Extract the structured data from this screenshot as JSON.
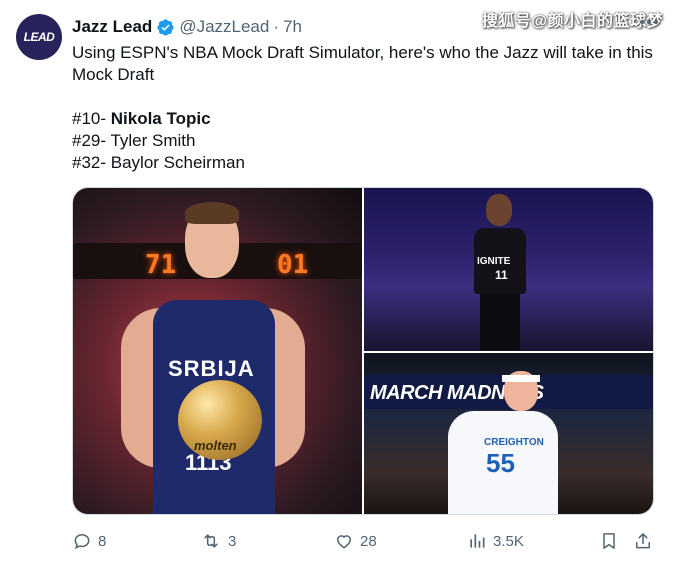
{
  "watermark": "搜狐号@颜小白的篮球梦",
  "tweet": {
    "avatar_text": "LEAD",
    "display_name": "Jazz Lead",
    "handle": "@JazzLead",
    "separator": "·",
    "time": "7h",
    "text_line1": "Using ESPN's NBA Mock Draft Simulator, here's who the Jazz will take in this Mock Draft",
    "picks": [
      {
        "prefix": "#10- ",
        "name": "Nikola Topic"
      },
      {
        "prefix": "#29- ",
        "name": "Tyler Smith"
      },
      {
        "prefix": "#32- ",
        "name": "Baylor Scheirman"
      }
    ]
  },
  "media": {
    "photo1": {
      "scoreboard_left": "71",
      "scoreboard_right": "01",
      "jersey_text": "SRBIJA",
      "jersey_text2": "1113",
      "ball_label": "molten"
    },
    "photo2": {
      "jersey_text": "IGNITE",
      "jersey_number": "11"
    },
    "photo3": {
      "banner_text": "MARCH MADNESS",
      "jersey_text": "CREIGHTON",
      "jersey_number": "55"
    }
  },
  "actions": {
    "reply_count": "8",
    "retweet_count": "3",
    "like_count": "28",
    "views_count": "3.5K"
  },
  "colors": {
    "text_primary": "#0f1419",
    "text_secondary": "#536471",
    "verified_blue": "#1d9bf0",
    "avatar_bg": "#28235a"
  }
}
